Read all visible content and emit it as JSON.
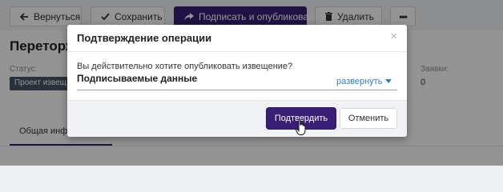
{
  "toolbar": {
    "back_label": "Вернуться",
    "save_label": "Сохранить",
    "sign_publish_label": "Подписать и опубликовать",
    "delete_label": "Удалить",
    "more_label": "•••"
  },
  "background": {
    "page_title": "Переторж",
    "status_label": "Статус:",
    "status_value": "Проект извещ",
    "bids_label": "Заявки:",
    "bids_value": "0",
    "tab_general": "Общая инфор"
  },
  "modal": {
    "title": "Подтверждение операции",
    "close_label": "×",
    "question": "Вы действительно хотите опубликовать извещение?",
    "signed_data_label": "Подписываемые данные",
    "expand_label": "развернуть",
    "confirm_label": "Подтвердить",
    "cancel_label": "Отменить"
  },
  "colors": {
    "primary": "#3a1f77",
    "link": "#2f7ec1",
    "overlay": "rgba(0,0,0,0.42)"
  },
  "icons": [
    "arrow-left-icon",
    "check-icon",
    "share-icon",
    "trash-icon",
    "more-icon",
    "close-icon",
    "caret-down-icon",
    "hand-cursor-icon"
  ]
}
